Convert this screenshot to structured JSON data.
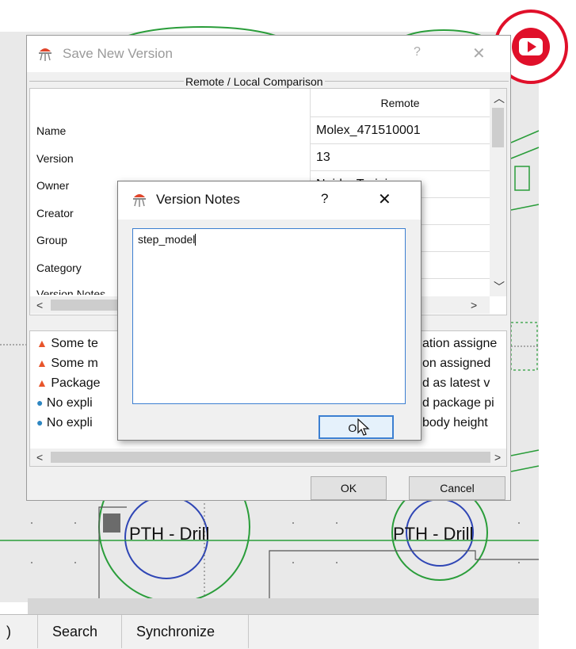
{
  "bottom_tabs": [
    ")",
    "Search",
    "Synchronize"
  ],
  "canvas": {
    "pth_labels": [
      "PTH - Drill",
      "PTH - Drill"
    ]
  },
  "save_dialog": {
    "title": "Save New Version",
    "help": "?",
    "close": "✕",
    "group_title": "Remote / Local Comparison",
    "column_header": "Remote",
    "rows": [
      {
        "label": "Name",
        "remote": "Molex_471510001"
      },
      {
        "label": "Version",
        "remote": "13"
      },
      {
        "label": "Owner",
        "remote": "Noida_Training"
      },
      {
        "label": "Creator",
        "remote": "_training"
      },
      {
        "label": "Group",
        "remote": ""
      },
      {
        "label": "Category",
        "remote": ""
      },
      {
        "label": "Version Notes",
        "remote": ""
      }
    ],
    "messages": [
      {
        "type": "warning",
        "left": "Some te",
        "right": "ation assigne"
      },
      {
        "type": "warning",
        "left": "Some m",
        "right": "on assigned"
      },
      {
        "type": "warning",
        "left": "Package",
        "right": "d as latest v"
      },
      {
        "type": "info",
        "left": "No expli",
        "right": "d package pi"
      },
      {
        "type": "info",
        "left": "No expli",
        "right": "body height"
      }
    ],
    "ok_label": "OK",
    "cancel_label": "Cancel"
  },
  "notes_dialog": {
    "title": "Version Notes",
    "help": "?",
    "close": "✕",
    "text": "step_model",
    "ok_label": "OK"
  },
  "icons": {
    "app_icon": "app-logo-icon",
    "warning": "warning-triangle-icon",
    "info": "info-circle-icon",
    "youtube": "youtube-play-icon"
  },
  "colors": {
    "warning": "#e8552b",
    "info": "#2e86c1",
    "youtube": "#e0102a",
    "focus": "#3c7fd1",
    "pad_green": "#2a9d3a",
    "pad_blue": "#2f46b5"
  }
}
